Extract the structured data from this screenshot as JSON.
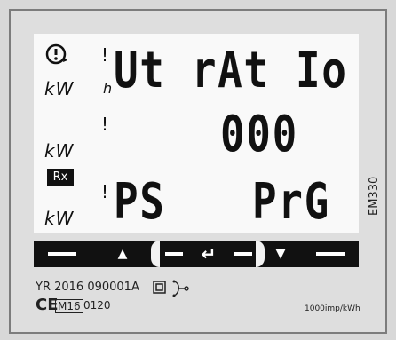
{
  "display": {
    "row1_text": "Ut rAt Io",
    "row2_text": "000",
    "row3_left": "PS",
    "row3_right": "PrG",
    "unit_label": "kW",
    "badge": "Rx"
  },
  "icons": {
    "alarm": "alarm-icon",
    "up": "up-arrow-icon",
    "enter": "enter-arrow-icon",
    "down": "down-arrow-icon"
  },
  "labels": {
    "model": "EM330",
    "serial": "YR 2016 090001A",
    "cert_mark": "M16",
    "cert_code": "0120",
    "ce": "CE",
    "pulse": "1000imp/kWh"
  },
  "buttons": {
    "up_glyph": "▲",
    "down_glyph": "▼",
    "enter_glyph": "↵"
  }
}
